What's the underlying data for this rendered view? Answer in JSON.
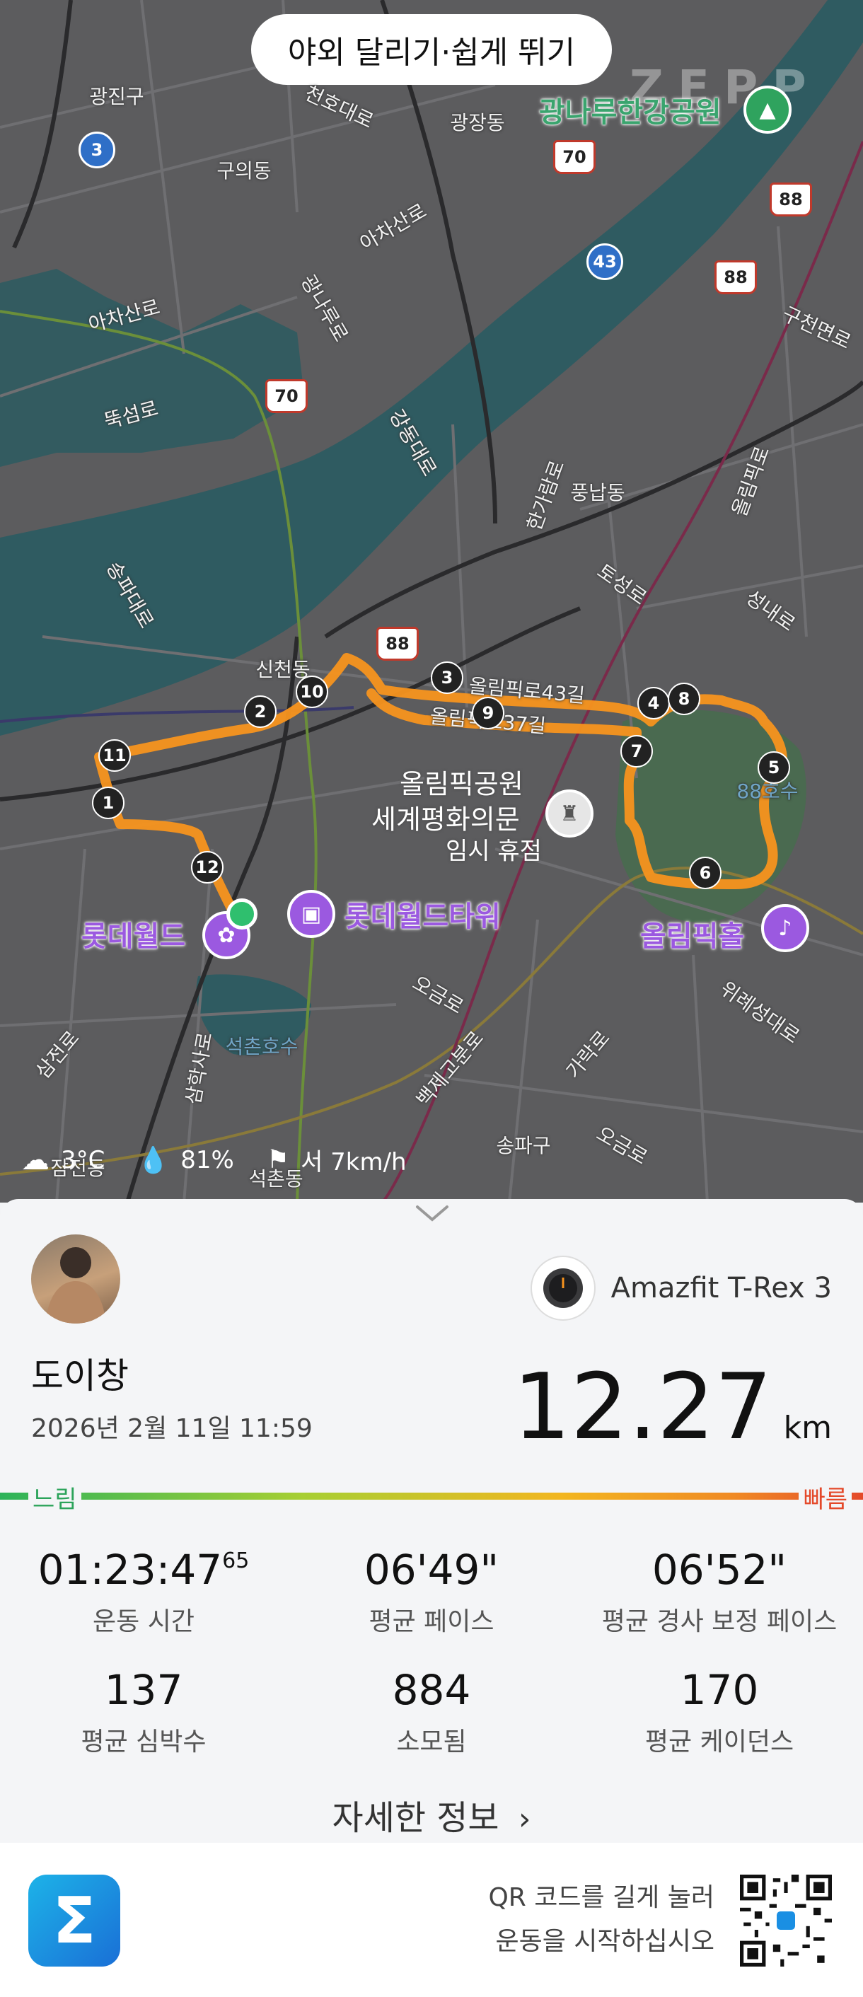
{
  "workout_type": "야외 달리기·쉽게 뛰기",
  "brand": "ZEPP",
  "map": {
    "areas": [
      {
        "id": "gwangjin",
        "text": "광진구"
      },
      {
        "id": "guui",
        "text": "구의동"
      },
      {
        "id": "gwangjang",
        "text": "광장동"
      },
      {
        "id": "pungnap",
        "text": "풍납동"
      },
      {
        "id": "sincheon",
        "text": "신천동"
      },
      {
        "id": "jamsil",
        "text": "잠전동"
      },
      {
        "id": "seokchon",
        "text": "석촌동"
      },
      {
        "id": "songpa",
        "text": "송파구"
      }
    ],
    "roads": [
      {
        "id": "cheonho",
        "text": "천호대로"
      },
      {
        "id": "achasan1",
        "text": "아차산로"
      },
      {
        "id": "achasan2",
        "text": "아차산로"
      },
      {
        "id": "ttukseom",
        "text": "뚝섬로"
      },
      {
        "id": "gwangnaru",
        "text": "광나루로"
      },
      {
        "id": "gangdong",
        "text": "강동대로"
      },
      {
        "id": "hangi",
        "text": "한가람로"
      },
      {
        "id": "songpadae",
        "text": "송파대로"
      },
      {
        "id": "olympic43",
        "text": "올림픽로43길"
      },
      {
        "id": "olympic37",
        "text": "올림픽로37길"
      },
      {
        "id": "toseong",
        "text": "토성로"
      },
      {
        "id": "seongnae",
        "text": "성내로"
      },
      {
        "id": "olympicro",
        "text": "올림픽로"
      },
      {
        "id": "gucheon",
        "text": "구천면로"
      },
      {
        "id": "ogeum1",
        "text": "오금로"
      },
      {
        "id": "baekje",
        "text": "백제고분로"
      },
      {
        "id": "garak",
        "text": "가락로"
      },
      {
        "id": "ogeum2",
        "text": "오금로"
      },
      {
        "id": "samjeon",
        "text": "삼전로"
      },
      {
        "id": "samhak",
        "text": "삼학사로"
      },
      {
        "id": "wirye",
        "text": "위례성대로"
      },
      {
        "id": "seokchonho",
        "text": "석촌호수"
      },
      {
        "id": "lake88",
        "text": "88호수"
      }
    ],
    "pois": {
      "gwangnaru_park": "광나루한강공원",
      "olympic_park_1": "올림픽공원",
      "olympic_park_2": "세계평화의문",
      "olympic_park_3": "임시 휴점",
      "lotte_world": "롯데월드",
      "lotte_tower": "롯데월드타워",
      "olympic_hall": "올림픽홀"
    },
    "shields": [
      "3",
      "70",
      "88",
      "43",
      "88",
      "70",
      "88"
    ],
    "km_markers": [
      "1",
      "2",
      "3",
      "4",
      "5",
      "6",
      "7",
      "8",
      "9",
      "10",
      "11",
      "12"
    ],
    "route_color": "#f7931e"
  },
  "weather": {
    "temp": "3°C",
    "humidity": "81%",
    "wind": "서 7km/h"
  },
  "user": {
    "name": "도이창",
    "datetime": "2026년 2월 11일 11:59"
  },
  "device": {
    "name": "Amazfit T-Rex 3"
  },
  "distance": {
    "value": "12.27",
    "unit": "km"
  },
  "pace_scale": {
    "slow": "느림",
    "fast": "빠름"
  },
  "stats": [
    {
      "value": "01:23:47",
      "sup": "65",
      "label": "운동 시간"
    },
    {
      "value": "06'49\"",
      "sup": "",
      "label": "평균 페이스"
    },
    {
      "value": "06'52\"",
      "sup": "",
      "label": "평균 경사 보정 페이스"
    },
    {
      "value": "137",
      "sup": "",
      "label": "평균 심박수"
    },
    {
      "value": "884",
      "sup": "",
      "label": "소모됨"
    },
    {
      "value": "170",
      "sup": "",
      "label": "평균 케이던스"
    }
  ],
  "more_info": "자세한 정보",
  "qr": {
    "line1": "QR 코드를 길게 눌러",
    "line2": "운동을 시작하십시오"
  },
  "colors": {
    "purple": "#9b59e0",
    "route": "#f7931e",
    "pace_slow": "#2ba35a",
    "pace_fast": "#e4492a"
  }
}
